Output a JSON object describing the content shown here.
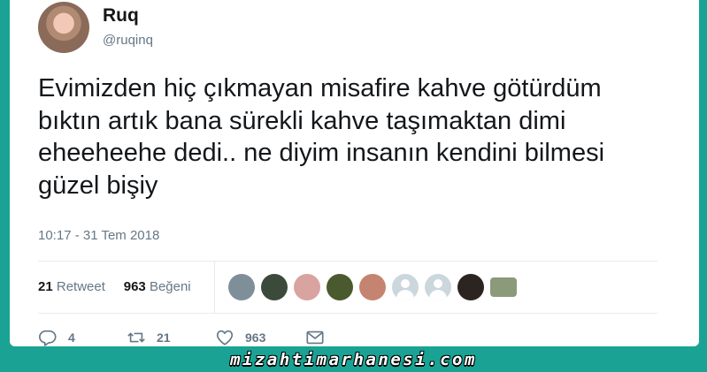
{
  "author": {
    "name": "Ruq",
    "handle": "@ruqinq"
  },
  "tweet": {
    "text": "Evimizden hiç çıkmayan misafire kahve götürdüm bıktın artık bana sürekli kahve taşımaktan dimi eheeheehe dedi.. ne diyim insanın kendini bilmesi güzel bişiy",
    "timestamp": "10:17 - 31 Tem 2018"
  },
  "stats": {
    "retweets": "21",
    "retweets_label": "Retweet",
    "likes": "963",
    "likes_label": "Beğeni"
  },
  "likers": [
    {
      "icon": "liker-avatar-1",
      "color": "#7f8f9a"
    },
    {
      "icon": "liker-avatar-2",
      "color": "#3b4a3a"
    },
    {
      "icon": "liker-avatar-3",
      "color": "#d9a3a0"
    },
    {
      "icon": "liker-avatar-4",
      "color": "#4a5a2e"
    },
    {
      "icon": "liker-avatar-5",
      "color": "#c58470"
    },
    {
      "icon": "default-avatar-icon",
      "color": "#ccd6dd"
    },
    {
      "icon": "default-avatar-icon",
      "color": "#ccd6dd"
    },
    {
      "icon": "liker-avatar-8",
      "color": "#2b2420"
    },
    {
      "icon": "liker-avatar-9",
      "color": "#8b9a7a"
    }
  ],
  "actions": {
    "reply_count": "4",
    "retweet_count": "21",
    "like_count": "963"
  },
  "watermark": "mizahtimarhanesi.com",
  "colors": {
    "background": "#1aa394",
    "text_primary": "#14171a",
    "text_secondary": "#657786",
    "divider": "#e6ecf0"
  }
}
